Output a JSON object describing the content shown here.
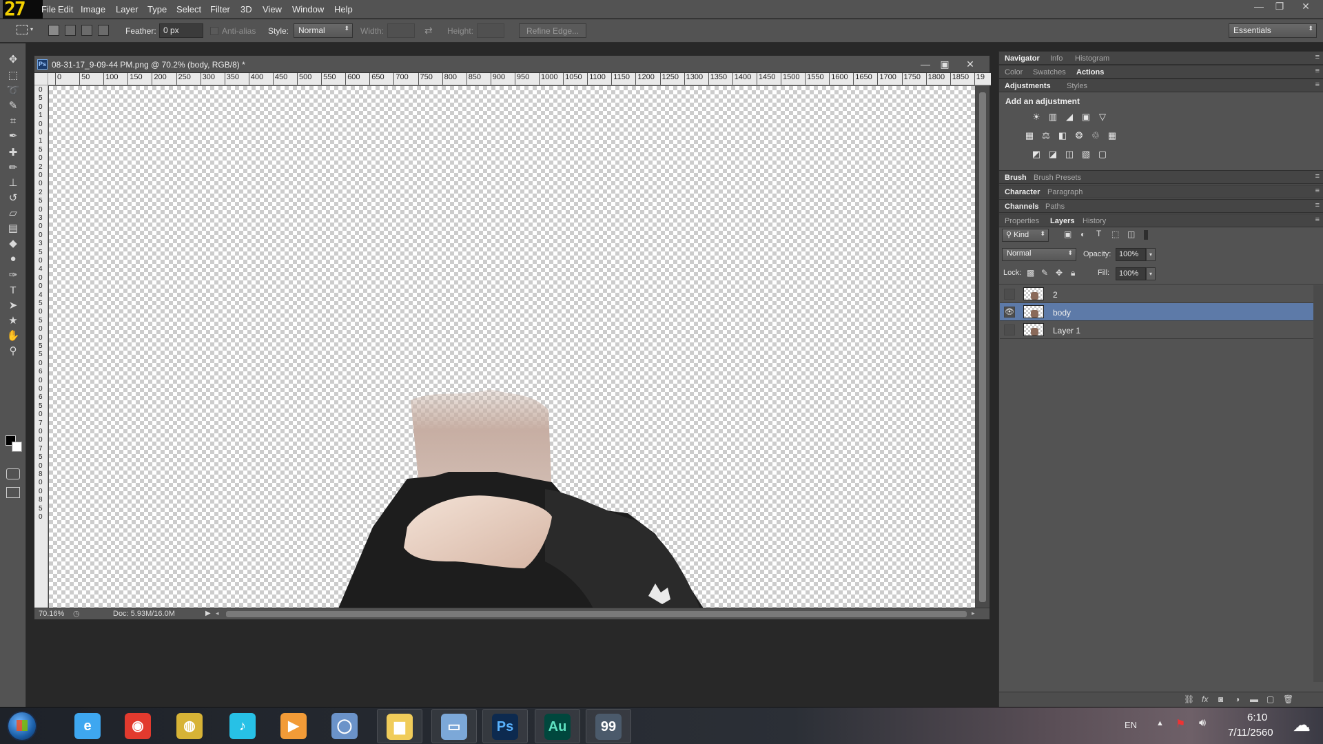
{
  "app": {
    "logo_text": "27",
    "menu": [
      "File",
      "Edit",
      "Image",
      "Layer",
      "Type",
      "Select",
      "Filter",
      "3D",
      "View",
      "Window",
      "Help"
    ]
  },
  "options_bar": {
    "feather_label": "Feather:",
    "feather_value": "0 px",
    "anti_alias_label": "Anti-alias",
    "style_label": "Style:",
    "style_value": "Normal",
    "width_label": "Width:",
    "height_label": "Height:",
    "refine_edge_label": "Refine Edge...",
    "workspace_value": "Essentials"
  },
  "tools": [
    {
      "name": "move-tool",
      "glyph": "✥"
    },
    {
      "name": "marquee-tool",
      "glyph": "⬚"
    },
    {
      "name": "lasso-tool",
      "glyph": "➰"
    },
    {
      "name": "quick-select-tool",
      "glyph": "✎"
    },
    {
      "name": "crop-tool",
      "glyph": "⌗"
    },
    {
      "name": "eyedropper-tool",
      "glyph": "✒"
    },
    {
      "name": "healing-brush-tool",
      "glyph": "✚"
    },
    {
      "name": "brush-tool",
      "glyph": "✏"
    },
    {
      "name": "clone-stamp-tool",
      "glyph": "⊥"
    },
    {
      "name": "history-brush-tool",
      "glyph": "↺"
    },
    {
      "name": "eraser-tool",
      "glyph": "▱"
    },
    {
      "name": "gradient-tool",
      "glyph": "▤"
    },
    {
      "name": "blur-tool",
      "glyph": "◆"
    },
    {
      "name": "dodge-tool",
      "glyph": "●"
    },
    {
      "name": "pen-tool",
      "glyph": "✑"
    },
    {
      "name": "type-tool",
      "glyph": "T"
    },
    {
      "name": "path-select-tool",
      "glyph": "➤"
    },
    {
      "name": "shape-tool",
      "glyph": "★"
    },
    {
      "name": "hand-tool",
      "glyph": "✋"
    },
    {
      "name": "zoom-tool",
      "glyph": "⚲"
    }
  ],
  "document": {
    "title": "08-31-17_9-09-44 PM.png @ 70.2% (body, RGB/8) *",
    "ps_badge": "Ps",
    "ruler_marks": [
      "0",
      "50",
      "100",
      "150",
      "200",
      "250",
      "300",
      "350",
      "400",
      "450",
      "500",
      "550",
      "600",
      "650",
      "700",
      "750",
      "800",
      "850",
      "900",
      "950",
      "1000",
      "1050",
      "1100",
      "1150",
      "1200",
      "1250",
      "1300",
      "1350",
      "1400",
      "1450",
      "1500",
      "1550",
      "1600",
      "1650",
      "1700",
      "1750",
      "1800",
      "1850",
      "19"
    ],
    "vruler_digits": [
      "0",
      "5",
      "0",
      "1",
      "0",
      "0",
      "1",
      "5",
      "0",
      "2",
      "0",
      "0",
      "2",
      "5",
      "0",
      "3",
      "0",
      "0",
      "3",
      "5",
      "0",
      "4",
      "0",
      "0",
      "4",
      "5",
      "0",
      "5",
      "0",
      "0",
      "5",
      "5",
      "0",
      "6",
      "0",
      "0",
      "6",
      "5",
      "0",
      "7",
      "0",
      "0",
      "7",
      "5",
      "0",
      "8",
      "0",
      "0",
      "8",
      "5",
      "0"
    ],
    "zoom_status": "70.16%",
    "doc_size": "Doc: 5.93M/16.0M"
  },
  "panels": {
    "group1_tabs": [
      "Navigator",
      "Info",
      "Histogram"
    ],
    "group2_tabs": [
      "Color",
      "Swatches",
      "Actions"
    ],
    "group3_tabs": [
      "Adjustments",
      "Styles"
    ],
    "adjust_heading": "Add an adjustment",
    "adjust_icons_row1": [
      "☀",
      "▥",
      "◢",
      "▣",
      "▽"
    ],
    "adjust_icons_row2": [
      "▦",
      "⚖",
      "◧",
      "❂",
      "♲",
      "▦"
    ],
    "adjust_icons_row3": [
      "◩",
      "◪",
      "◫",
      "▧",
      "▢"
    ],
    "brush_tabs": [
      "Brush",
      "Brush Presets"
    ],
    "char_tabs": [
      "Character",
      "Paragraph"
    ],
    "channel_tabs": [
      "Channels",
      "Paths"
    ],
    "layer_tabs": [
      "Properties",
      "Layers",
      "History"
    ],
    "kind_filter": "Kind",
    "blend_mode": "Normal",
    "opacity_label": "Opacity:",
    "opacity_value": "100%",
    "lock_label": "Lock:",
    "fill_label": "Fill:",
    "fill_value": "100%",
    "layers": [
      {
        "name": "2",
        "visible": false,
        "selected": false
      },
      {
        "name": "body",
        "visible": true,
        "selected": true
      },
      {
        "name": "Layer 1",
        "visible": false,
        "selected": false
      }
    ]
  },
  "taskbar": {
    "apps": [
      {
        "name": "internet-explorer",
        "glyph": "e",
        "color": "#3ea7f0"
      },
      {
        "name": "weibo-app",
        "glyph": "◉",
        "color": "#e23a2e"
      },
      {
        "name": "chrome-app",
        "glyph": "◍",
        "color": "#d7b336"
      },
      {
        "name": "music-app",
        "glyph": "♪",
        "color": "#27c1e6"
      },
      {
        "name": "media-player",
        "glyph": "▶",
        "color": "#f29b37"
      },
      {
        "name": "browser-app",
        "glyph": "◯",
        "color": "#6b93c9"
      },
      {
        "name": "file-explorer",
        "glyph": "▆",
        "color": "#f0cc5a"
      },
      {
        "name": "remote-desktop",
        "glyph": "▭",
        "color": "#7ca8d8"
      },
      {
        "name": "photoshop",
        "glyph": "Ps",
        "color": "#0d2a4f"
      },
      {
        "name": "audition",
        "glyph": "Au",
        "color": "#00473d"
      },
      {
        "name": "calculator-app",
        "glyph": "99",
        "color": "#4b5a6b"
      }
    ],
    "language": "EN",
    "time": "6:10",
    "date": "7/11/2560"
  },
  "colors": {
    "ps_logo_yellow": "#f3d000",
    "selection_blue": "#5d7aa8",
    "panel_gray": "#535353"
  }
}
